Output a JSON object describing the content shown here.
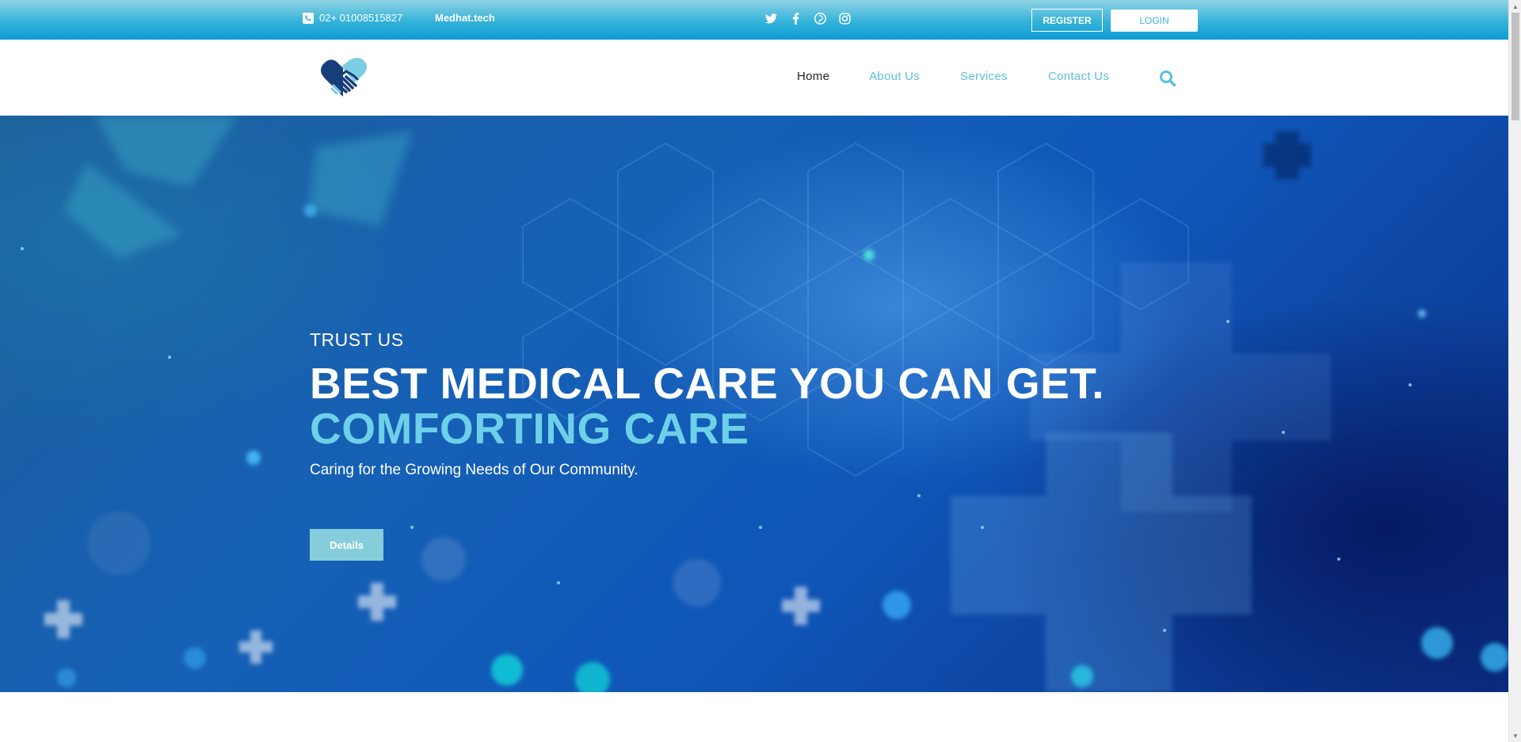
{
  "topbar": {
    "phone": "02+ 01008515827",
    "site": "Medhat.tech",
    "socials": [
      "twitter-icon",
      "facebook-icon",
      "pinterest-icon",
      "instagram-icon"
    ],
    "register_label": "REGISTER",
    "login_label": "LOGIN"
  },
  "nav": {
    "items": [
      {
        "label": "Home",
        "active": true
      },
      {
        "label": "About Us",
        "active": false
      },
      {
        "label": "Services",
        "active": false
      },
      {
        "label": "Contact Us",
        "active": false
      }
    ]
  },
  "hero": {
    "eyebrow": "TRUST US",
    "headline": "BEST MEDICAL CARE YOU CAN GET.",
    "subheadline": "COMFORTING CARE",
    "tagline": "Caring for the Growing Needs of Our Community.",
    "button_label": "Details"
  },
  "colors": {
    "accent": "#5bc0de",
    "topbar": "#1aa5d8",
    "hero_highlight": "#6ed0e8",
    "details_button": "#86cddb"
  }
}
